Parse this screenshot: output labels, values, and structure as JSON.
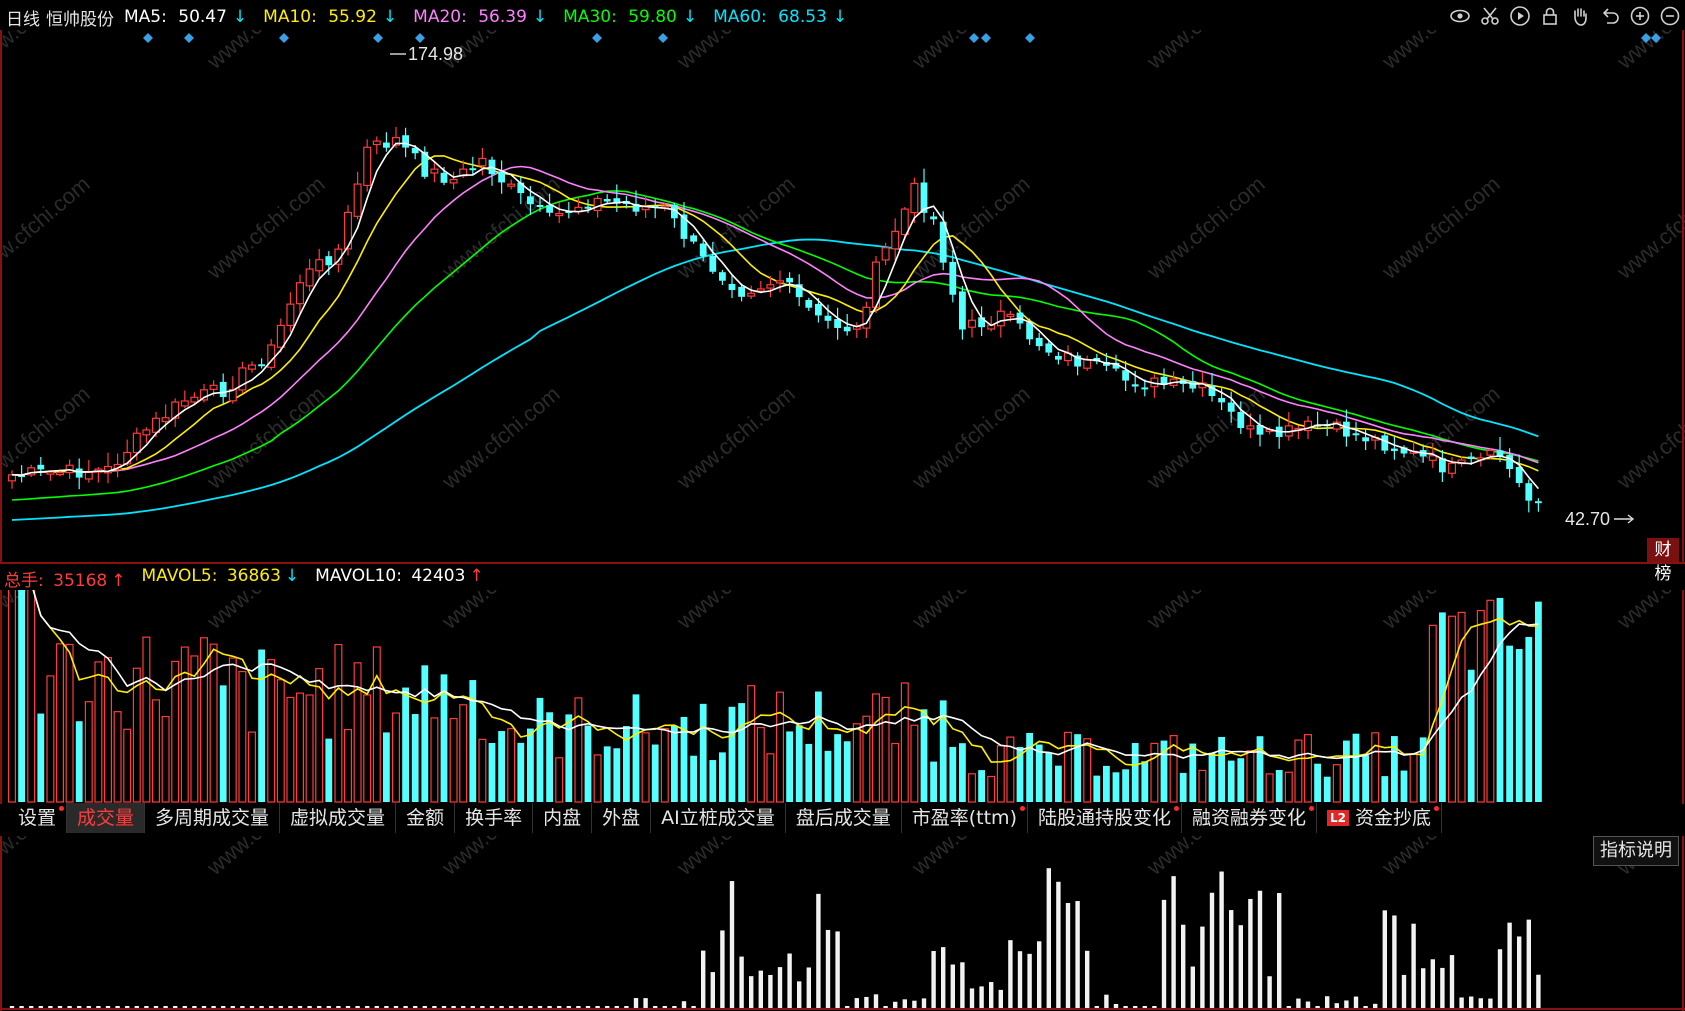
{
  "header": {
    "period": "日线",
    "stock_name": "恒帅股份",
    "ma": [
      {
        "label": "MA5:",
        "value": "50.47",
        "arrow": "↓",
        "color": "#ffffff"
      },
      {
        "label": "MA10:",
        "value": "55.92",
        "arrow": "↓",
        "color": "#ffee00"
      },
      {
        "label": "MA20:",
        "value": "56.39",
        "arrow": "↓",
        "color": "#ff80ff"
      },
      {
        "label": "MA30:",
        "value": "59.80",
        "arrow": "↓",
        "color": "#00ff00"
      },
      {
        "label": "MA60:",
        "value": "68.53",
        "arrow": "↓",
        "color": "#00e5ff"
      }
    ]
  },
  "toolbar": {
    "icons": [
      "eye-icon",
      "scissors-icon",
      "play-icon",
      "lock-icon",
      "hand-icon",
      "undo-icon",
      "zoom-in-icon",
      "zoom-out-icon"
    ]
  },
  "price_chart": {
    "high_label": "174.98",
    "low_label": "42.70",
    "side_badge": "财榜"
  },
  "volume": {
    "total_label": "总手:",
    "total_value": "35168",
    "total_arrow": "↑",
    "mavol5_label": "MAVOL5:",
    "mavol5_value": "36863",
    "mavol5_arrow": "↓",
    "mavol10_label": "MAVOL10:",
    "mavol10_value": "42403",
    "mavol10_arrow": "↑"
  },
  "tabs": [
    {
      "label": "设置",
      "dot": true,
      "active": false
    },
    {
      "label": "成交量",
      "dot": false,
      "active": true
    },
    {
      "label": "多周期成交量",
      "dot": false,
      "active": false
    },
    {
      "label": "虚拟成交量",
      "dot": false,
      "active": false
    },
    {
      "label": "金额",
      "dot": false,
      "active": false
    },
    {
      "label": "换手率",
      "dot": false,
      "active": false
    },
    {
      "label": "内盘",
      "dot": false,
      "active": false
    },
    {
      "label": "外盘",
      "dot": false,
      "active": false
    },
    {
      "label": "AI立桩成交量",
      "dot": false,
      "active": false
    },
    {
      "label": "盘后成交量",
      "dot": false,
      "active": false
    },
    {
      "label": "市盈率(ttm)",
      "dot": true,
      "active": false
    },
    {
      "label": "陆股通持股变化",
      "dot": true,
      "active": false
    },
    {
      "label": "融资融券变化",
      "dot": true,
      "active": false
    },
    {
      "label": "资金抄底",
      "dot": true,
      "active": false,
      "badge": "L2"
    }
  ],
  "indicator_button": "指标说明",
  "watermark": "www.cfchi.com",
  "colors": {
    "up": "#ff3b3b",
    "down": "#54ffff",
    "frame": "#8a1010"
  }
}
